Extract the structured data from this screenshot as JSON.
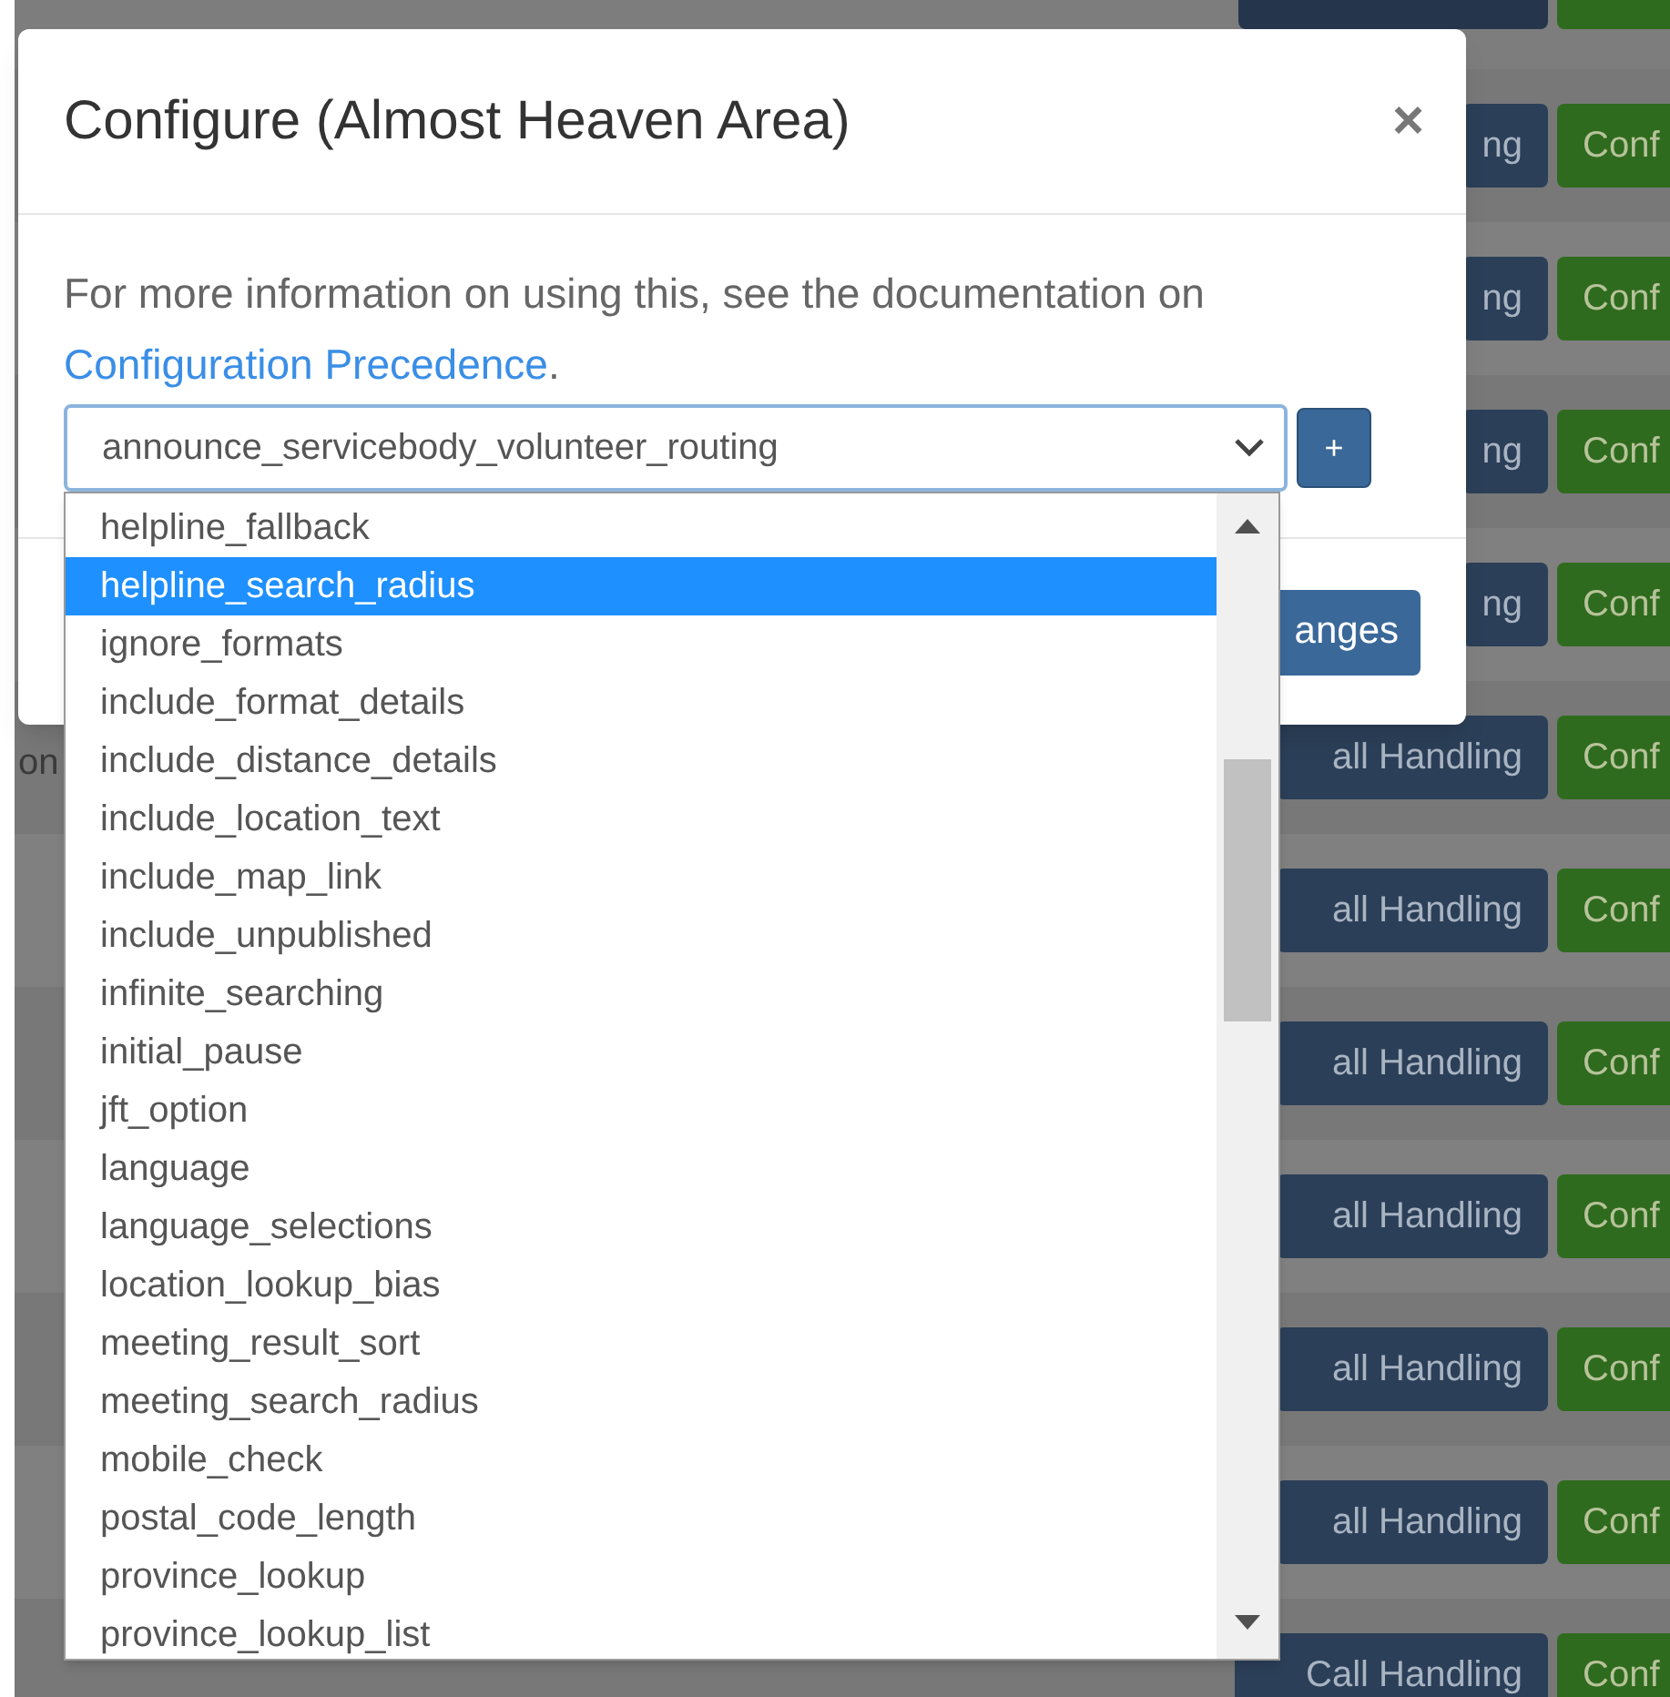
{
  "background": {
    "side_text": "on",
    "rows": [
      {
        "handling_label": "ng",
        "configure_label": "Conf"
      },
      {
        "handling_label": "ng",
        "configure_label": "Conf"
      },
      {
        "handling_label": "ng",
        "configure_label": "Conf"
      },
      {
        "handling_label": "ng",
        "configure_label": "Conf"
      },
      {
        "handling_label": "all Handling",
        "configure_label": "Conf"
      },
      {
        "handling_label": "all Handling",
        "configure_label": "Conf"
      },
      {
        "handling_label": "all Handling",
        "configure_label": "Conf"
      },
      {
        "handling_label": "all Handling",
        "configure_label": "Conf"
      },
      {
        "handling_label": "all Handling",
        "configure_label": "Conf"
      },
      {
        "handling_label": "all Handling",
        "configure_label": "Conf"
      },
      {
        "handling_label": "Call Handling",
        "configure_label": "Conf"
      }
    ]
  },
  "modal": {
    "title": "Configure (Almost Heaven Area)",
    "close": "×",
    "info_text": "For more information on using this, see the documentation on",
    "link": "Configuration Precedence",
    "link_suffix": ".",
    "select_value": "announce_servicebody_volunteer_routing",
    "add_button": "+",
    "footer_button": "anges"
  },
  "dropdown": {
    "options": [
      {
        "label": "helpline_fallback",
        "selected": false
      },
      {
        "label": "helpline_search_radius",
        "selected": true
      },
      {
        "label": "ignore_formats",
        "selected": false
      },
      {
        "label": "include_format_details",
        "selected": false
      },
      {
        "label": "include_distance_details",
        "selected": false
      },
      {
        "label": "include_location_text",
        "selected": false
      },
      {
        "label": "include_map_link",
        "selected": false
      },
      {
        "label": "include_unpublished",
        "selected": false
      },
      {
        "label": "infinite_searching",
        "selected": false
      },
      {
        "label": "initial_pause",
        "selected": false
      },
      {
        "label": "jft_option",
        "selected": false
      },
      {
        "label": "language",
        "selected": false
      },
      {
        "label": "language_selections",
        "selected": false
      },
      {
        "label": "location_lookup_bias",
        "selected": false
      },
      {
        "label": "meeting_result_sort",
        "selected": false
      },
      {
        "label": "meeting_search_radius",
        "selected": false
      },
      {
        "label": "mobile_check",
        "selected": false
      },
      {
        "label": "postal_code_length",
        "selected": false
      },
      {
        "label": "province_lookup",
        "selected": false
      },
      {
        "label": "province_lookup_list",
        "selected": false
      }
    ]
  }
}
